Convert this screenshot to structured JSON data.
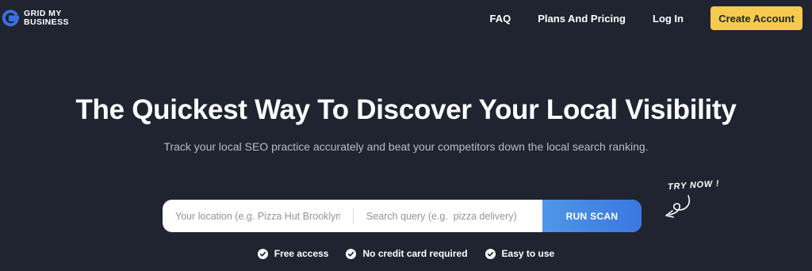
{
  "brand": {
    "line1": "GRID MY",
    "line2": "BUSINESS"
  },
  "nav": {
    "faq": "FAQ",
    "pricing": "Plans And Pricing",
    "login": "Log In",
    "cta": "Create Account"
  },
  "hero": {
    "title": "The Quickest Way To Discover Your Local Visibility",
    "subtitle": "Track your local SEO practice accurately and beat your competitors down the local search ranking."
  },
  "search": {
    "location_placeholder": "Your location (e.g. Pizza Hut Brooklyn)",
    "query_placeholder": "Search query (e.g.  pizza delivery)",
    "button": "RUN SCAN"
  },
  "try_now": "TRY NOW !",
  "features": [
    "Free access",
    "No credit card required",
    "Easy to use"
  ],
  "colors": {
    "background": "#1f2430",
    "cta": "#f6c94f",
    "button_gradient_start": "#4f97e6",
    "button_gradient_end": "#3b77e0",
    "logo_blue": "#3b6fe0"
  }
}
